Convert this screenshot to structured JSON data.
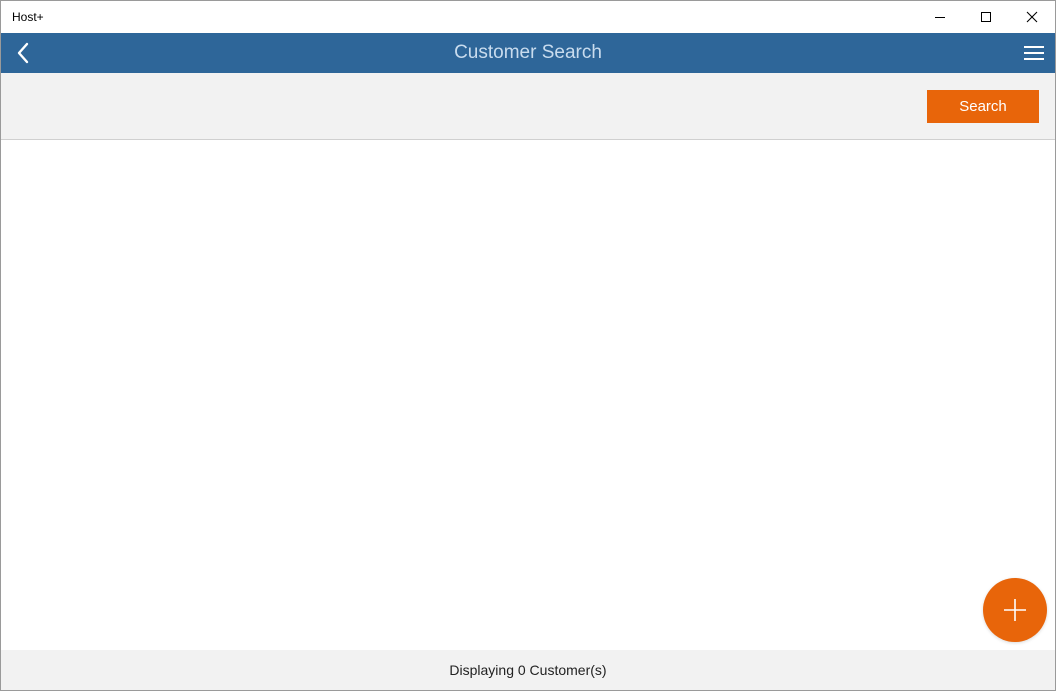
{
  "window": {
    "title": "Host+"
  },
  "header": {
    "title": "Customer Search",
    "back_icon": "chevron-left-icon",
    "menu_icon": "hamburger-menu-icon"
  },
  "toolbar": {
    "search_label": "Search"
  },
  "results": {
    "items": []
  },
  "fab": {
    "icon": "plus-icon"
  },
  "status": {
    "text": "Displaying 0 Customer(s)"
  },
  "colors": {
    "header_bg": "#2e6699",
    "accent": "#e8650a",
    "toolbar_bg": "#f2f2f2"
  }
}
